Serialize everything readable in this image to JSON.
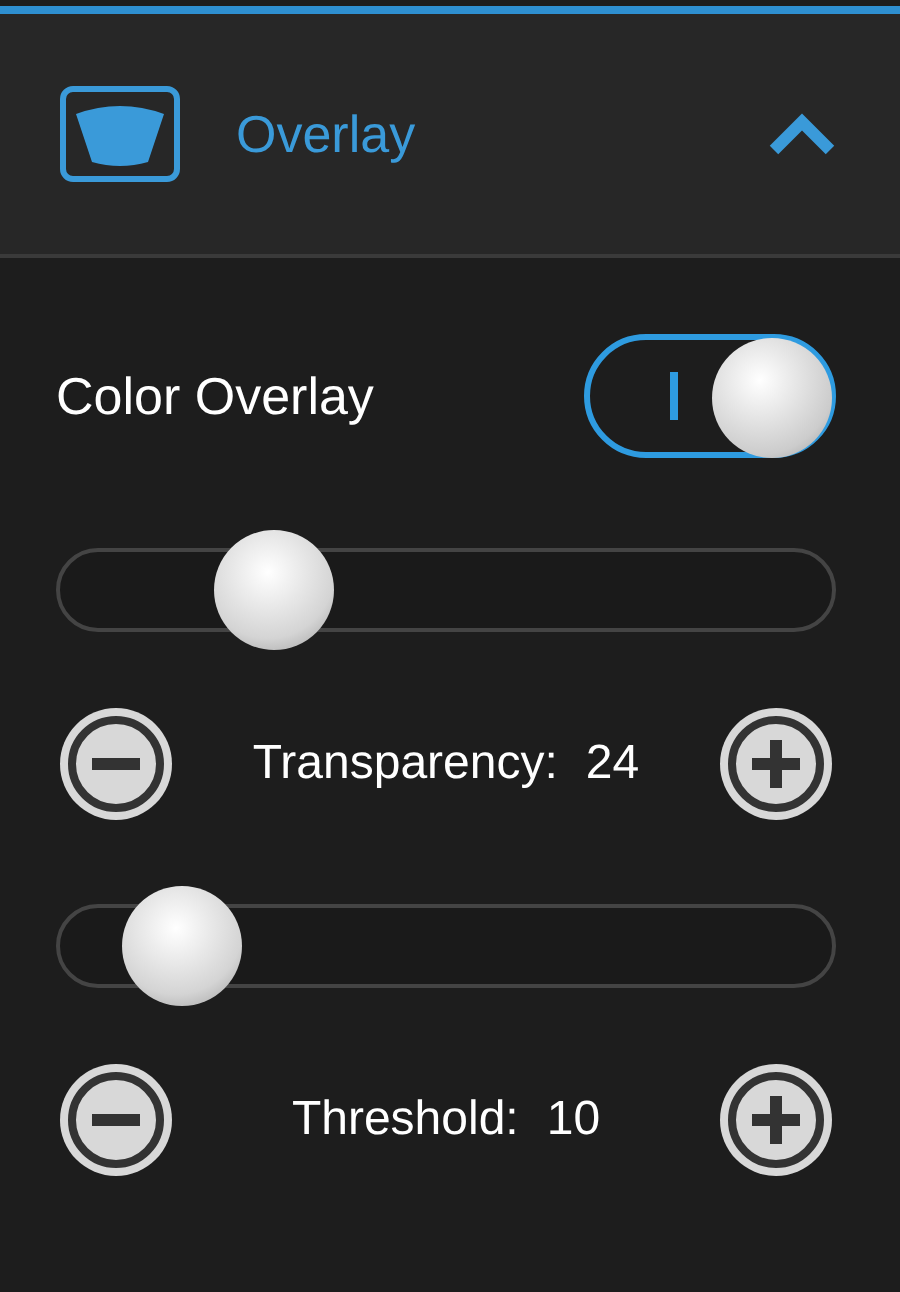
{
  "header": {
    "title": "Overlay",
    "expanded": true
  },
  "toggle": {
    "label": "Color Overlay",
    "on": true
  },
  "controls": [
    {
      "label": "Transparency:",
      "value": "24",
      "level": 0.24
    },
    {
      "label": "Threshold:",
      "value": "10",
      "level": 0.1
    }
  ]
}
